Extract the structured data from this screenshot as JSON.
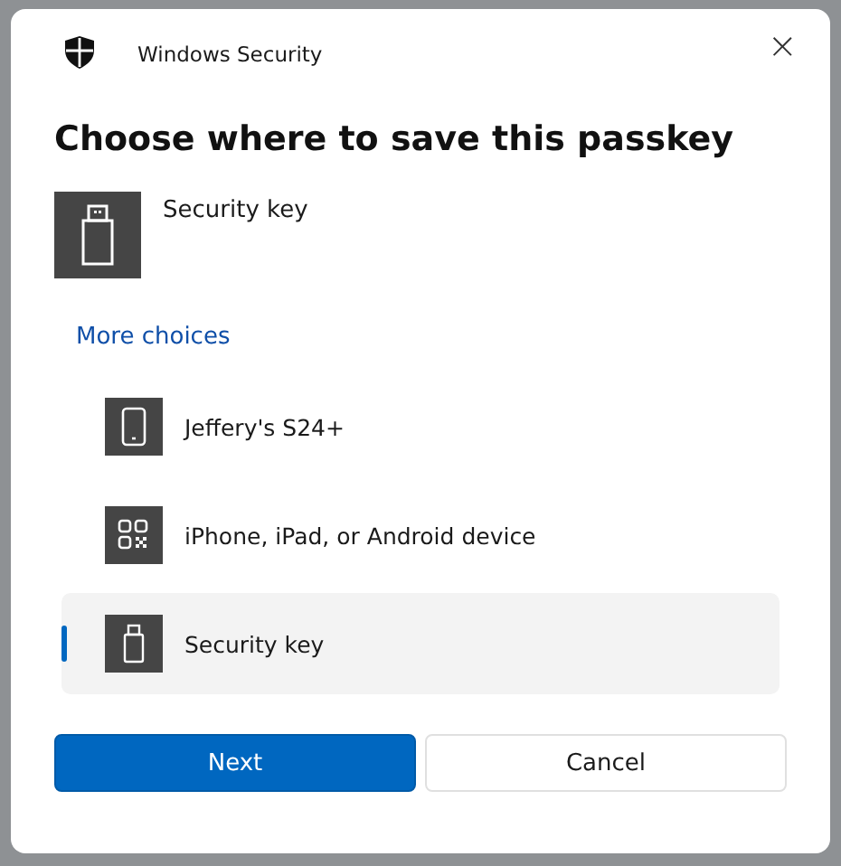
{
  "window": {
    "title": "Windows Security",
    "close": "×"
  },
  "heading": "Choose where to save this passkey",
  "current_choice": {
    "label": "Security key",
    "kind": "usb"
  },
  "more_choices": "More choices",
  "options": [
    {
      "label": "Jeffery's S24+",
      "kind": "phone",
      "selected": false
    },
    {
      "label": "iPhone, iPad, or Android device",
      "kind": "qr",
      "selected": false
    },
    {
      "label": "Security key",
      "kind": "usb",
      "selected": true
    }
  ],
  "buttons": [
    {
      "label": "Next",
      "kind": "primary"
    },
    {
      "label": "Cancel",
      "kind": "secondary"
    }
  ]
}
